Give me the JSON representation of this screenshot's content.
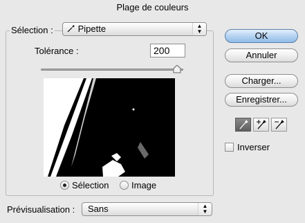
{
  "window": {
    "title": "Plage de couleurs"
  },
  "selection": {
    "label": "Sélection :",
    "value": "Pipette"
  },
  "tolerance": {
    "label": "Tolérance :",
    "value": "200",
    "slider_fraction": 0.98
  },
  "preview_mode": {
    "option_selection": "Sélection",
    "option_image": "Image",
    "selected": "Sélection"
  },
  "previsualisation": {
    "label": "Prévisualisation :",
    "value": "Sans"
  },
  "buttons": {
    "ok": "OK",
    "cancel": "Annuler",
    "load": "Charger...",
    "save": "Enregistrer..."
  },
  "eyedroppers": [
    {
      "icon": "eyedropper-icon",
      "active": true
    },
    {
      "icon": "eyedropper-plus-icon",
      "active": false
    },
    {
      "icon": "eyedropper-minus-icon",
      "active": false
    }
  ],
  "invert": {
    "label": "Inverser",
    "checked": false
  }
}
